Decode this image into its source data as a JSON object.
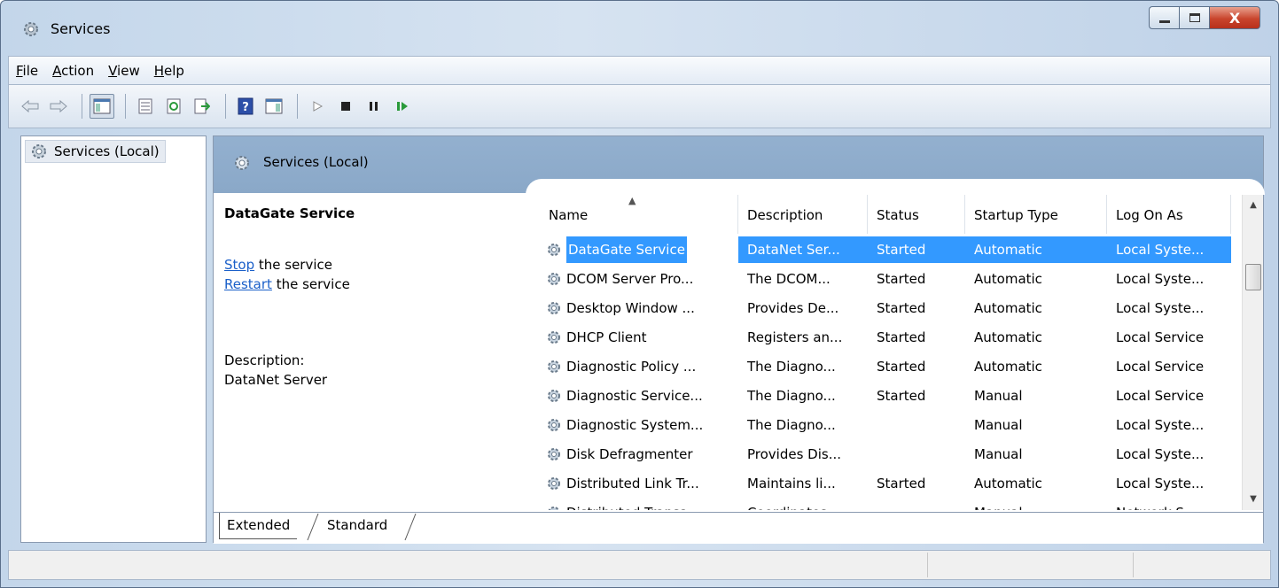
{
  "window": {
    "title": "Services",
    "icon": "gear-icon",
    "buttons": {
      "minimize": "minimize-icon",
      "maximize": "maximize-icon",
      "close_label": "X"
    }
  },
  "menubar": {
    "items": [
      {
        "label": "File",
        "accel": "F"
      },
      {
        "label": "Action",
        "accel": "A"
      },
      {
        "label": "View",
        "accel": "V"
      },
      {
        "label": "Help",
        "accel": "H"
      }
    ]
  },
  "toolbar": {
    "icons": [
      "back-icon",
      "forward-icon",
      "show-hide-tree-icon",
      "properties-icon",
      "refresh-icon",
      "export-icon",
      "help-icon",
      "show-action-pane-icon",
      "start-icon",
      "stop-icon",
      "pause-icon",
      "restart-icon"
    ]
  },
  "tree": {
    "root_label": "Services (Local)"
  },
  "main": {
    "header_title": "Services (Local)",
    "selected_service": "DataGate Service",
    "actions": [
      {
        "link": "Stop",
        "rest": " the service"
      },
      {
        "link": "Restart",
        "rest": " the service"
      }
    ],
    "description_label": "Description:",
    "description_value": "DataNet Server"
  },
  "table": {
    "columns": [
      "Name",
      "Description",
      "Status",
      "Startup Type",
      "Log On As"
    ],
    "sorted_column": "Name",
    "rows": [
      [
        "DataGate Service",
        "DataNet Ser...",
        "Started",
        "Automatic",
        "Local Syste..."
      ],
      [
        "DCOM Server Pro...",
        "The DCOM...",
        "Started",
        "Automatic",
        "Local Syste..."
      ],
      [
        "Desktop Window ...",
        "Provides De...",
        "Started",
        "Automatic",
        "Local Syste..."
      ],
      [
        "DHCP Client",
        "Registers an...",
        "Started",
        "Automatic",
        "Local Service"
      ],
      [
        "Diagnostic Policy ...",
        "The Diagno...",
        "Started",
        "Automatic",
        "Local Service"
      ],
      [
        "Diagnostic Service...",
        "The Diagno...",
        "Started",
        "Manual",
        "Local Service"
      ],
      [
        "Diagnostic System...",
        "The Diagno...",
        "",
        "Manual",
        "Local Syste..."
      ],
      [
        "Disk Defragmenter",
        "Provides Dis...",
        "",
        "Manual",
        "Local Syste..."
      ],
      [
        "Distributed Link Tr...",
        "Maintains li...",
        "Started",
        "Automatic",
        "Local Syste..."
      ],
      [
        "Distributed Transa...",
        "Coordinates...",
        "",
        "Manual",
        "Network S..."
      ]
    ],
    "selected_row": 0
  },
  "tabs": [
    "Extended",
    "Standard"
  ],
  "colors": {
    "selection": "#3399ff",
    "link": "#1a5fc9",
    "header_band": "#8aa8c8"
  }
}
